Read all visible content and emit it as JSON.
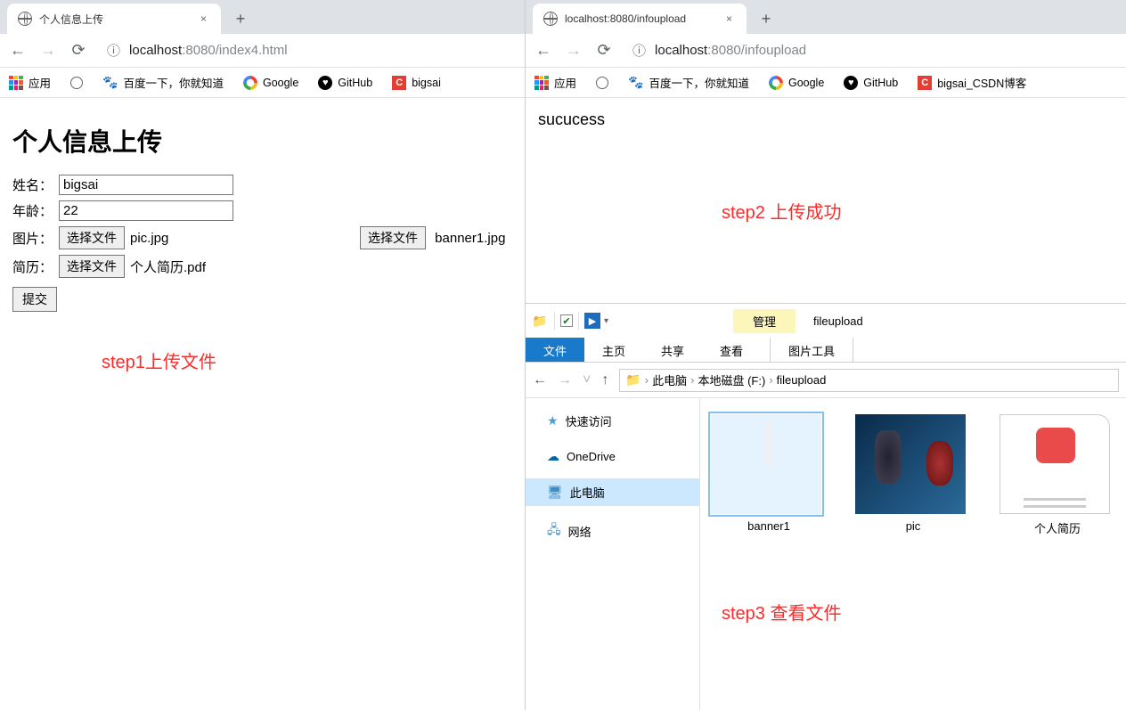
{
  "left": {
    "tab_title": "个人信息上传",
    "url_host": "localhost",
    "url_path": ":8080/index4.html",
    "page_title": "个人信息上传",
    "labels": {
      "name": "姓名：",
      "age": "年龄：",
      "image": "图片：",
      "resume": "简历："
    },
    "values": {
      "name": "bigsai",
      "age": "22"
    },
    "file_btn": "选择文件",
    "files": {
      "image": "pic.jpg",
      "extra": "banner1.jpg",
      "resume": "个人简历.pdf"
    },
    "submit": "提交",
    "step": "step1上传文件"
  },
  "right": {
    "tab_title": "localhost:8080/infoupload",
    "url_host": "localhost",
    "url_path": ":8080/infoupload",
    "success": "sucucess",
    "step2": "step2 上传成功",
    "step3": "step3 查看文件"
  },
  "bookmarks": {
    "apps": "应用",
    "baidu": "百度一下，你就知道",
    "google": "Google",
    "github": "GitHub",
    "csdn_short": "bigsai",
    "csdn_long": "bigsai_CSDN博客"
  },
  "explorer": {
    "manage": "管理",
    "location": "fileupload",
    "ribbon": {
      "file": "文件",
      "home": "主页",
      "share": "共享",
      "view": "查看",
      "pic_tools": "图片工具"
    },
    "crumbs": {
      "pc": "此电脑",
      "drive": "本地磁盘 (F:)",
      "folder": "fileupload"
    },
    "sidebar": {
      "quick": "快速访问",
      "onedrive": "OneDrive",
      "pc": "此电脑",
      "network": "网络"
    },
    "files": {
      "banner": "banner1",
      "pic": "pic",
      "resume": "个人简历"
    }
  }
}
